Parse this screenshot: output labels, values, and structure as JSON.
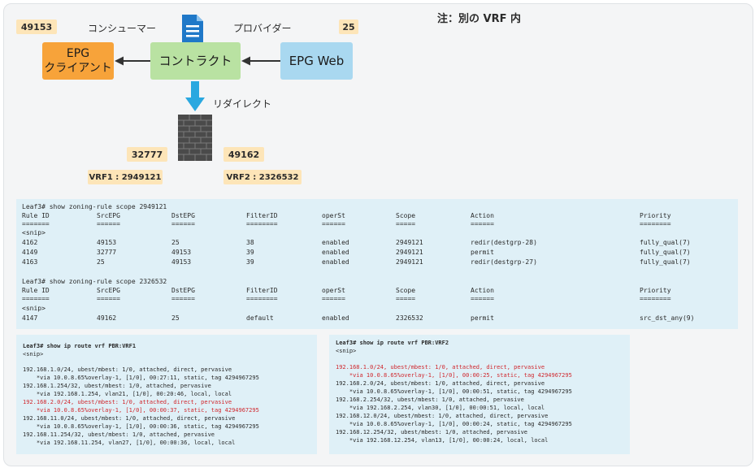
{
  "note": "注：別の VRF 内",
  "diagram": {
    "consumer_pctag": "49153",
    "provider_pctag": "25",
    "consumer_label": "コンシューマー",
    "provider_label": "プロバイダー",
    "epg_client": "EPG\nクライアント",
    "contract": "コントラクト",
    "epg_web": "EPG Web",
    "redirect_label": "リダイレクト",
    "fw_left_pctag": "32777",
    "fw_right_pctag": "49162",
    "vrf1": "VRF1 : 2949121",
    "vrf2": "VRF2 : 2326532",
    "colors": {
      "epg_client": "#f7a33a",
      "contract": "#b9e2a2",
      "epg_web": "#a9d8f0",
      "badge": "#fde5b8",
      "redirect_arrow": "#2aa8e0",
      "highlight_text": "#d0282e"
    },
    "icons": [
      "contract-document-icon",
      "firewall-icon",
      "redirect-arrow-icon",
      "arrow-left-icon"
    ]
  },
  "zoning": {
    "headers": [
      "Rule ID",
      "SrcEPG",
      "DstEPG",
      "FilterID",
      "operSt",
      "Scope",
      "Action",
      "Priority"
    ],
    "separators": [
      "=======",
      "======",
      "======",
      "========",
      "======",
      "=====",
      "======",
      "========"
    ],
    "snip": "<snip>",
    "block1": {
      "command": "Leaf3# show zoning-rule scope 2949121",
      "rows": [
        [
          "4162",
          "49153",
          "25",
          "38",
          "enabled",
          "2949121",
          "redir(destgrp-28)",
          "fully_qual(7)"
        ],
        [
          "4149",
          "32777",
          "49153",
          "39",
          "enabled",
          "2949121",
          "permit",
          "fully_qual(7)"
        ],
        [
          "4163",
          "25",
          "49153",
          "39",
          "enabled",
          "2949121",
          "redir(destgrp-27)",
          "fully_qual(7)"
        ]
      ]
    },
    "block2": {
      "command": "Leaf3# show zoning-rule scope 2326532",
      "rows": [
        [
          "4147",
          "49162",
          "25",
          "default",
          "enabled",
          "2326532",
          "permit",
          "src_dst_any(9)"
        ]
      ]
    }
  },
  "routes_vrf1": {
    "command": "Leaf3# show ip route vrf PBR:VRF1",
    "lines": [
      "<snip>",
      "192.168.1.0/24, ubest/mbest: 1/0, attached, direct, pervasive",
      "    *via 10.0.8.65%overlay-1, [1/0], 00:27:11, static, tag 4294967295",
      "192.168.1.254/32, ubest/mbest: 1/0, attached, pervasive",
      "    *via 192.168.1.254, vlan21, [1/0], 00:20:46, local, local",
      "192.168.2.0/24, ubest/mbest: 1/0, attached, direct, pervasive",
      "    *via 10.0.8.65%overlay-1, [1/0], 00:00:37, static, tag 4294967295",
      "192.168.11.0/24, ubest/mbest: 1/0, attached, direct, pervasive",
      "    *via 10.0.8.65%overlay-1, [1/0], 00:00:36, static, tag 4294967295",
      "192.168.11.254/32, ubest/mbest: 1/0, attached, pervasive",
      "    *via 192.168.11.254, vlan27, [1/0], 00:00:36, local, local"
    ]
  },
  "routes_vrf2": {
    "command": "Leaf3# show ip route vrf PBR:VRF2",
    "lines": [
      "<snip>",
      "192.168.1.0/24, ubest/mbest: 1/0, attached, direct, pervasive",
      "    *via 10.0.8.65%overlay-1, [1/0], 00:00:25, static, tag 4294967295",
      "192.168.2.0/24, ubest/mbest: 1/0, attached, direct, pervasive",
      "    *via 10.0.8.65%overlay-1, [1/0], 00:00:51, static, tag 4294967295",
      "192.168.2.254/32, ubest/mbest: 1/0, attached, pervasive",
      "    *via 192.168.2.254, vlan30, [1/0], 00:00:51, local, local",
      "192.168.12.0/24, ubest/mbest: 1/0, attached, direct, pervasive",
      "    *via 10.0.8.65%overlay-1, [1/0], 00:00:24, static, tag 4294967295",
      "192.168.12.254/32, ubest/mbest: 1/0, attached, pervasive",
      "    *via 192.168.12.254, vlan13, [1/0], 00:00:24, local, local"
    ]
  }
}
